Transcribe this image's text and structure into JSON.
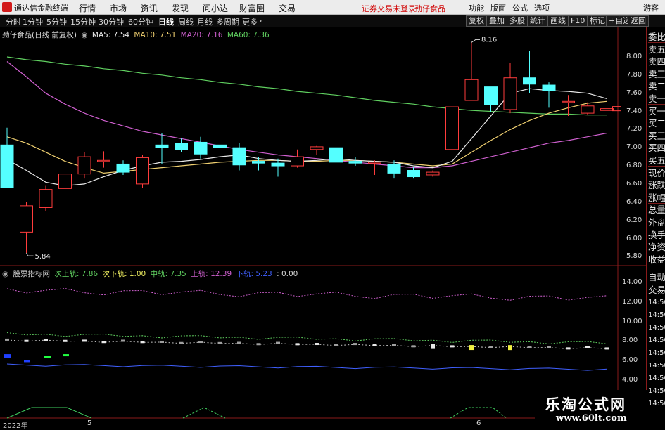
{
  "menubar": {
    "app_title": "通达信金融终端",
    "items": [
      "行情",
      "市场",
      "资讯",
      "发现",
      "问小达",
      "财富圈",
      "交易"
    ],
    "status_text": "证券交易未登录",
    "stock_name": "劲仔食品",
    "right_items": [
      "功能",
      "版面",
      "公式",
      "选项"
    ],
    "guest": "游客"
  },
  "toolbar": {
    "periods": [
      "分时",
      "1分钟",
      "5分钟",
      "15分钟",
      "30分钟",
      "60分钟",
      "日线",
      "周线",
      "月线",
      "多周期",
      "更多"
    ],
    "active_period": "日线",
    "buttons": [
      "复权",
      "叠加",
      "多股",
      "统计",
      "画线",
      "F10",
      "标记",
      "+自选",
      "返回"
    ]
  },
  "legend_main": {
    "title": "劲仔食品(日线 前复权)",
    "ma5": "MA5: 7.54",
    "ma10": "MA10: 7.51",
    "ma20": "MA20: 7.16",
    "ma60": "MA60: 7.36",
    "colors": {
      "ma5": "#e8e8e8",
      "ma10": "#f0d070",
      "ma20": "#d060d0",
      "ma60": "#60d060"
    }
  },
  "legend_indicator": {
    "name": "股票指标网",
    "next_upper": "次上轨: 7.86",
    "next_lower": "次下轨: 1.00",
    "middle": "中轨: 7.35",
    "upper": "上轨: 12.39",
    "lower": "下轨: 5.23",
    "tail": ": 0.00"
  },
  "price_axis": [
    "8.00",
    "7.80",
    "7.60",
    "7.40",
    "7.20",
    "7.00",
    "6.80",
    "6.60",
    "6.40",
    "6.20",
    "6.00",
    "5.80"
  ],
  "indicator_axis": [
    "14.00",
    "12.00",
    "10.00",
    "8.00",
    "6.00",
    "4.00"
  ],
  "annotations": {
    "high": "8.16",
    "low": "5.84"
  },
  "right_panel_top": [
    "委比",
    "卖五",
    "卖四",
    "卖三",
    "卖二",
    "卖一",
    "买一",
    "买二",
    "买三",
    "买四",
    "买五",
    "现价",
    "涨跌",
    "涨幅",
    "总量",
    "外盘",
    "换手",
    "净资",
    "收益"
  ],
  "right_panel_bottom": [
    "自动",
    "交易",
    "14:50",
    "14:50",
    "14:50",
    "14:50",
    "14:50",
    "14:50",
    "14:50",
    "14:50",
    "14:50"
  ],
  "x_dates": [
    "2022年",
    "5",
    "6"
  ],
  "watermark": {
    "line1": "乐淘公式网",
    "line2": "www.60lt.com"
  },
  "chart_data": {
    "type": "candlestick",
    "ylim": [
      5.75,
      8.2
    ],
    "colors": {
      "up": "#ff3c3c",
      "down": "#54ffff",
      "ma5": "#e8e8e8",
      "ma10": "#f0d070",
      "ma20": "#d060d0",
      "ma60": "#60d060"
    },
    "candles": [
      {
        "o": 7.03,
        "h": 7.22,
        "l": 6.56,
        "c": 6.56
      },
      {
        "o": 6.07,
        "h": 6.4,
        "l": 5.84,
        "c": 6.36
      },
      {
        "o": 6.34,
        "h": 6.58,
        "l": 6.3,
        "c": 6.54
      },
      {
        "o": 6.55,
        "h": 6.8,
        "l": 6.53,
        "c": 6.71
      },
      {
        "o": 6.71,
        "h": 6.95,
        "l": 6.66,
        "c": 6.9
      },
      {
        "o": 6.86,
        "h": 6.96,
        "l": 6.78,
        "c": 6.86
      },
      {
        "o": 6.82,
        "h": 6.86,
        "l": 6.7,
        "c": 6.73
      },
      {
        "o": 6.6,
        "h": 6.92,
        "l": 6.56,
        "c": 6.89
      },
      {
        "o": 7.03,
        "h": 7.16,
        "l": 6.82,
        "c": 7.0
      },
      {
        "o": 7.05,
        "h": 7.1,
        "l": 6.95,
        "c": 6.98
      },
      {
        "o": 7.06,
        "h": 7.12,
        "l": 6.88,
        "c": 6.93
      },
      {
        "o": 7.03,
        "h": 7.1,
        "l": 6.9,
        "c": 7.0
      },
      {
        "o": 7.0,
        "h": 7.05,
        "l": 6.75,
        "c": 6.81
      },
      {
        "o": 6.85,
        "h": 6.9,
        "l": 6.75,
        "c": 6.83
      },
      {
        "o": 6.83,
        "h": 6.88,
        "l": 6.68,
        "c": 6.8
      },
      {
        "o": 6.8,
        "h": 6.98,
        "l": 6.78,
        "c": 6.9
      },
      {
        "o": 6.98,
        "h": 7.02,
        "l": 6.92,
        "c": 7.01
      },
      {
        "o": 7.0,
        "h": 7.3,
        "l": 6.72,
        "c": 6.84
      },
      {
        "o": 6.85,
        "h": 6.9,
        "l": 6.8,
        "c": 6.83
      },
      {
        "o": 6.84,
        "h": 6.86,
        "l": 6.7,
        "c": 6.84
      },
      {
        "o": 6.82,
        "h": 6.86,
        "l": 6.66,
        "c": 6.72
      },
      {
        "o": 6.75,
        "h": 6.79,
        "l": 6.66,
        "c": 6.68
      },
      {
        "o": 6.7,
        "h": 6.75,
        "l": 6.68,
        "c": 6.73
      },
      {
        "o": 6.98,
        "h": 7.47,
        "l": 6.83,
        "c": 7.45
      },
      {
        "o": 7.52,
        "h": 8.16,
        "l": 7.52,
        "c": 7.75
      },
      {
        "o": 7.67,
        "h": 7.67,
        "l": 7.39,
        "c": 7.47
      },
      {
        "o": 7.42,
        "h": 7.93,
        "l": 7.38,
        "c": 7.77
      },
      {
        "o": 7.77,
        "h": 8.07,
        "l": 7.6,
        "c": 7.7
      },
      {
        "o": 7.69,
        "h": 7.72,
        "l": 7.44,
        "c": 7.63
      },
      {
        "o": 7.51,
        "h": 7.58,
        "l": 7.35,
        "c": 7.51
      },
      {
        "o": 7.38,
        "h": 7.5,
        "l": 7.36,
        "c": 7.46
      },
      {
        "o": 7.41,
        "h": 7.46,
        "l": 7.3,
        "c": 7.43
      }
    ],
    "ma_lines": {
      "ma5": [
        6.87,
        6.75,
        6.62,
        6.58,
        6.6,
        6.68,
        6.75,
        6.8,
        6.84,
        6.85,
        6.87,
        6.9,
        6.92,
        6.88,
        6.86,
        6.85,
        6.86,
        6.88,
        6.86,
        6.85,
        6.84,
        6.8,
        6.78,
        6.85,
        7.1,
        7.35,
        7.6,
        7.65,
        7.63,
        7.62,
        7.6,
        7.54
      ],
      "ma10": [
        7.12,
        7.05,
        6.95,
        6.85,
        6.78,
        6.72,
        6.74,
        6.76,
        6.78,
        6.8,
        6.82,
        6.84,
        6.85,
        6.86,
        6.86,
        6.85,
        6.85,
        6.86,
        6.86,
        6.85,
        6.84,
        6.82,
        6.8,
        6.82,
        6.95,
        7.08,
        7.2,
        7.3,
        7.38,
        7.44,
        7.49,
        7.51
      ],
      "ma20": [
        7.95,
        7.78,
        7.6,
        7.48,
        7.38,
        7.3,
        7.24,
        7.18,
        7.14,
        7.1,
        7.06,
        7.02,
        6.98,
        6.95,
        6.92,
        6.9,
        6.88,
        6.86,
        6.84,
        6.82,
        6.8,
        6.78,
        6.78,
        6.8,
        6.85,
        6.9,
        6.95,
        7.0,
        7.05,
        7.08,
        7.12,
        7.16
      ],
      "ma60": [
        8.0,
        7.97,
        7.95,
        7.92,
        7.9,
        7.87,
        7.85,
        7.82,
        7.8,
        7.77,
        7.75,
        7.72,
        7.7,
        7.67,
        7.65,
        7.62,
        7.6,
        7.58,
        7.55,
        7.52,
        7.5,
        7.48,
        7.45,
        7.43,
        7.41,
        7.4,
        7.39,
        7.38,
        7.37,
        7.37,
        7.36,
        7.36
      ]
    }
  }
}
